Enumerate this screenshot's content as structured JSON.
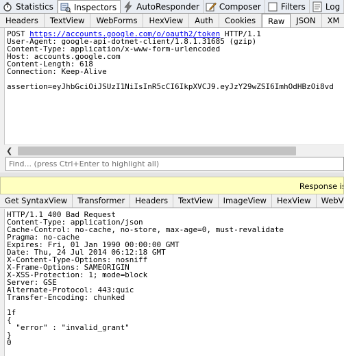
{
  "main_tabs": [
    {
      "label": "Statistics",
      "icon": "stopwatch-icon",
      "active": false
    },
    {
      "label": "Inspectors",
      "icon": "inspect-icon",
      "active": true
    },
    {
      "label": "AutoResponder",
      "icon": "lightning-icon",
      "active": false
    },
    {
      "label": "Composer",
      "icon": "composer-icon",
      "active": false
    },
    {
      "label": "Filters",
      "icon": "checkbox-icon",
      "active": false
    },
    {
      "label": "Log",
      "icon": "log-icon",
      "active": false
    },
    {
      "label": "T",
      "icon": "timeline-icon",
      "active": false
    }
  ],
  "request_tabs": [
    "Headers",
    "TextView",
    "WebForms",
    "HexView",
    "Auth",
    "Cookies",
    "Raw",
    "JSON",
    "XM"
  ],
  "request_active_tab": "Raw",
  "request": {
    "method": "POST ",
    "url": "https://accounts.google.com/o/oauth2/token",
    "protocol": " HTTP/1.1",
    "headers": [
      "User-Agent: google-api-dotnet-client/1.8.1.31685 (gzip)",
      "Content-Type: application/x-www-form-urlencoded",
      "Host: accounts.google.com",
      "Content-Length: 618",
      "Connection: Keep-Alive"
    ],
    "body": "assertion=eyJhbGciOiJSUzI1NiIsInR5cCI6IkpXVCJ9.eyJzY29wZSI6ImhOdHBzOi8vd"
  },
  "find_placeholder": "Find... (press Ctrl+Enter to highlight all)",
  "response_banner": "Response is",
  "response_tabs": [
    "Get SyntaxView",
    "Transformer",
    "Headers",
    "TextView",
    "ImageView",
    "HexView",
    "WebView"
  ],
  "response": {
    "lines": [
      "HTTP/1.1 400 Bad Request",
      "Content-Type: application/json",
      "Cache-Control: no-cache, no-store, max-age=0, must-revalidate",
      "Pragma: no-cache",
      "Expires: Fri, 01 Jan 1990 00:00:00 GMT",
      "Date: Thu, 24 Jul 2014 06:12:18 GMT",
      "X-Content-Type-Options: nosniff",
      "X-Frame-Options: SAMEORIGIN",
      "X-XSS-Protection: 1; mode=block",
      "Server: GSE",
      "Alternate-Protocol: 443:quic",
      "Transfer-Encoding: chunked",
      "",
      "1f",
      "{",
      "  \"error\" : \"invalid_grant\"",
      "}",
      "0"
    ]
  }
}
